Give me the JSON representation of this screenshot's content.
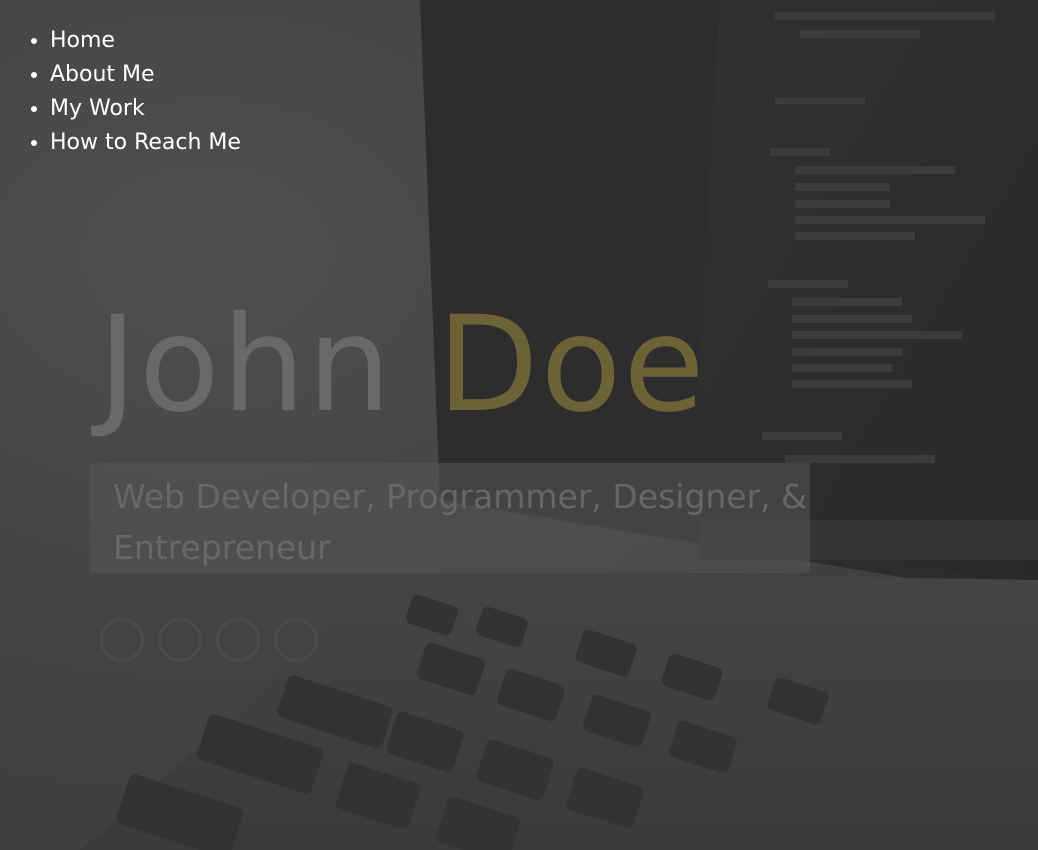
{
  "nav": {
    "items": [
      {
        "label": "Home"
      },
      {
        "label": "About Me"
      },
      {
        "label": "My Work"
      },
      {
        "label": "How to Reach Me"
      }
    ]
  },
  "hero": {
    "first_name": "John",
    "last_name": "Doe",
    "tagline": "Web Developer, Programmer, Designer, & Entrepreneur"
  },
  "background": {
    "description_icon": "laptop-code-photo-icon"
  },
  "social": {
    "icons": [
      "social-icon-1",
      "social-icon-2",
      "social-icon-3",
      "social-icon-4"
    ]
  },
  "colors": {
    "nav_text": "#ffffff",
    "first_name": "#6e6e6e",
    "last_name": "#786c38",
    "tagline": "#696969"
  }
}
